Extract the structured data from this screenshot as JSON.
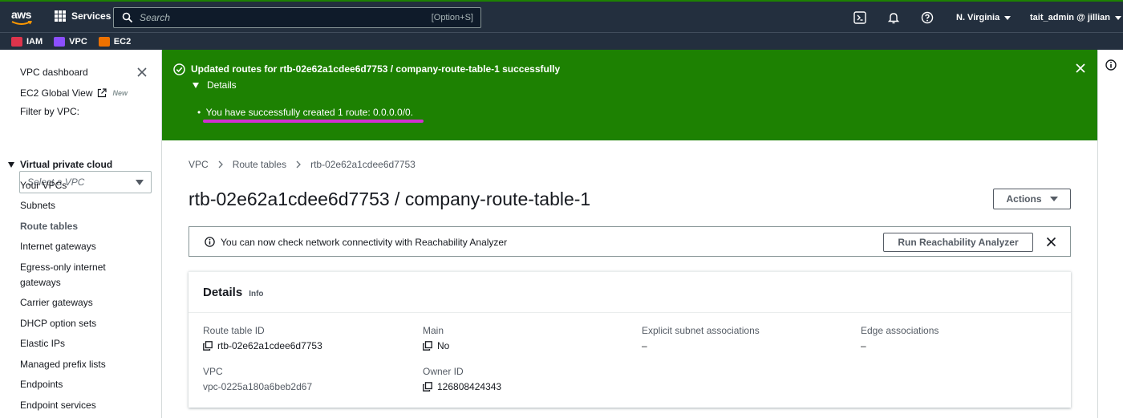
{
  "topnav": {
    "logo": "aws",
    "services_label": "Services",
    "search_placeholder": "Search",
    "search_shortcut": "[Option+S]",
    "region": "N. Virginia",
    "user": "tait_admin @ jillian"
  },
  "favorites": [
    {
      "label": "IAM",
      "color": "#dd344c"
    },
    {
      "label": "VPC",
      "color": "#8c4fff"
    },
    {
      "label": "EC2",
      "color": "#ed7100"
    }
  ],
  "sidebar": {
    "dashboard": "VPC dashboard",
    "ec2_global": "EC2 Global View",
    "ec2_badge": "New",
    "filter_label": "Filter by VPC:",
    "filter_placeholder": "Select a VPC",
    "section": "Virtual private cloud",
    "items": [
      "Your VPCs",
      "Subnets",
      "Route tables",
      "Internet gateways",
      "Egress-only internet",
      "gateways",
      "Carrier gateways",
      "DHCP option sets",
      "Elastic IPs",
      "Managed prefix lists",
      "Endpoints",
      "Endpoint services"
    ]
  },
  "flash": {
    "title": "Updated routes for rtb-02e62a1cdee6d7753 / company-route-table-1 successfully",
    "details_label": "Details",
    "message": "You have successfully created 1 route: 0.0.0.0/0.",
    "color": "#1d8102"
  },
  "breadcrumb": [
    "VPC",
    "Route tables",
    "rtb-02e62a1cdee6d7753"
  ],
  "page_title": "rtb-02e62a1cdee6d7753 / company-route-table-1",
  "actions_label": "Actions",
  "reachability": {
    "message": "You can now check network connectivity with Reachability Analyzer",
    "button": "Run Reachability Analyzer"
  },
  "details": {
    "header": "Details",
    "info": "Info",
    "route_table_id_label": "Route table ID",
    "route_table_id": "rtb-02e62a1cdee6d7753",
    "main_label": "Main",
    "main": "No",
    "explicit_label": "Explicit subnet associations",
    "explicit": "–",
    "edge_label": "Edge associations",
    "edge": "–",
    "vpc_label": "VPC",
    "vpc": "vpc-0225a180a6beb2d67",
    "owner_label": "Owner ID",
    "owner": "126808424343"
  }
}
